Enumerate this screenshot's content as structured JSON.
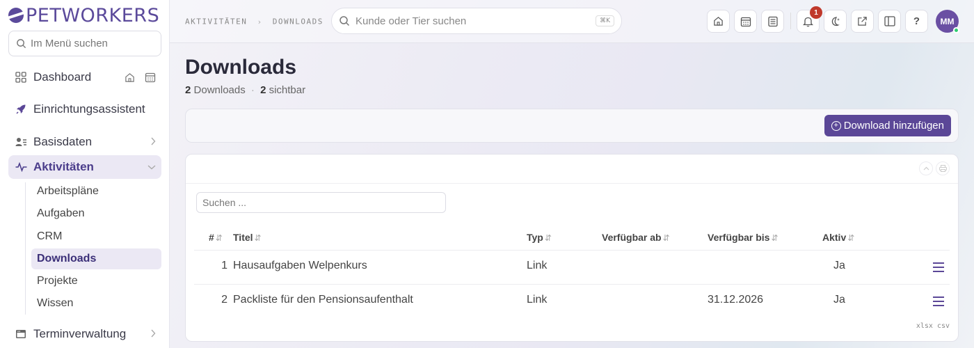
{
  "app": {
    "logo": "PETWORKERS"
  },
  "sidebar": {
    "search_placeholder": "Im Menü suchen",
    "items": [
      {
        "label": "Dashboard"
      },
      {
        "label": "Einrichtungsassistent"
      },
      {
        "label": "Basisdaten"
      },
      {
        "label": "Aktivitäten"
      },
      {
        "label": "Terminverwaltung"
      }
    ],
    "subitems": [
      "Arbeitspläne",
      "Aufgaben",
      "CRM",
      "Downloads",
      "Projekte",
      "Wissen"
    ]
  },
  "topbar": {
    "breadcrumb": [
      "AKTIVITÄTEN",
      "DOWNLOADS"
    ],
    "breadcrumb_sep": "›",
    "search_placeholder": "Kunde oder Tier suchen",
    "search_shortcut": "⌘K",
    "notifications_count": "1",
    "help_label": "?",
    "avatar_initials": "MM"
  },
  "page": {
    "title": "Downloads",
    "count_total": "2",
    "count_total_label": "Downloads",
    "count_visible": "2",
    "count_visible_label": "sichtbar",
    "add_button": "Download hinzufügen"
  },
  "table": {
    "search_placeholder": "Suchen ...",
    "columns": [
      "#",
      "Titel",
      "Typ",
      "Verfügbar ab",
      "Verfügbar bis",
      "Aktiv"
    ],
    "rows": [
      {
        "num": "1",
        "title": "Hausaufgaben Welpenkurs",
        "type": "Link",
        "from": "",
        "to": "",
        "active": "Ja"
      },
      {
        "num": "2",
        "title": "Packliste für den Pensionsaufenthalt",
        "type": "Link",
        "from": "",
        "to": "31.12.2026",
        "active": "Ja"
      }
    ],
    "export_xlsx": "xlsx",
    "export_csv": "csv"
  },
  "colors": {
    "brand": "#5b4797",
    "active_bg": "#ebe8f4",
    "badge": "#c0392b"
  }
}
